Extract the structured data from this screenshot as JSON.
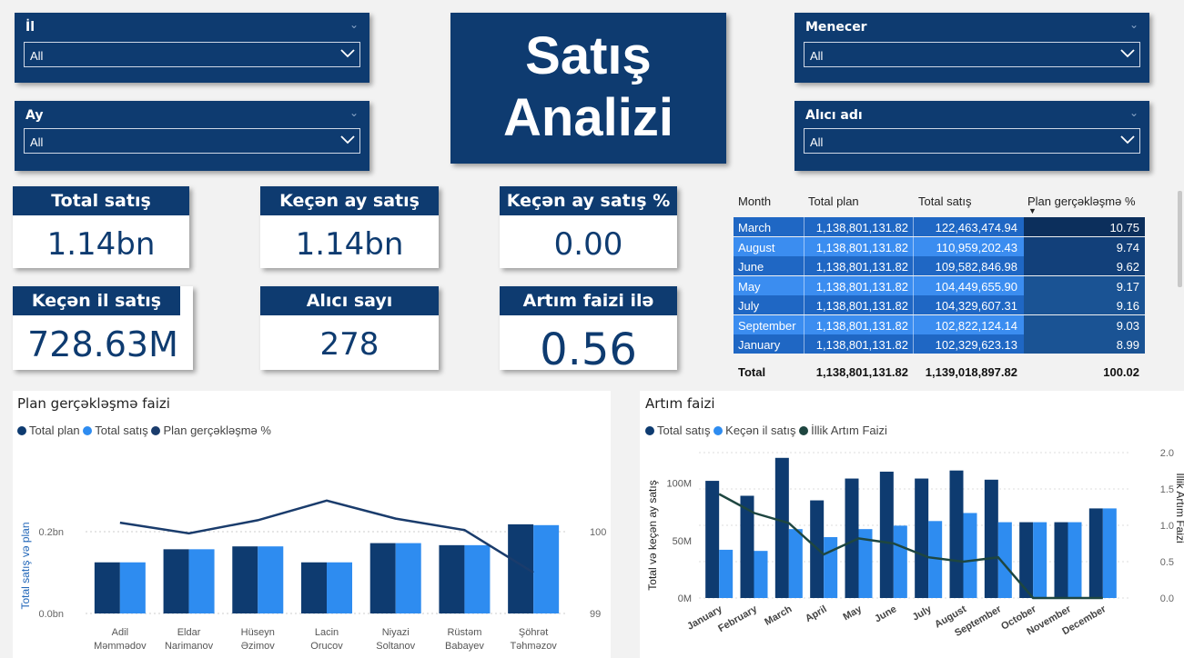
{
  "colors": {
    "navy": "#0e3b70",
    "blue": "#2e8cf0",
    "dark_line": "#1a3c6c",
    "green_line": "#1e4640"
  },
  "slicers": {
    "year": {
      "title": "İl",
      "value": "All"
    },
    "month": {
      "title": "Ay",
      "value": "All"
    },
    "manager": {
      "title": "Menecer",
      "value": "All"
    },
    "buyer": {
      "title": "Alıcı adı",
      "value": "All"
    }
  },
  "title": {
    "line1": "Satış",
    "line2": "Analizi"
  },
  "cards": {
    "total_sales": {
      "label": "Total satış",
      "value": "1.14bn"
    },
    "last_month_sales": {
      "label": "Keçən ay satış",
      "value": "1.14bn"
    },
    "last_month_pct": {
      "label": "Keçən ay satış %",
      "value": "0.00"
    },
    "last_year_sales": {
      "label": "Keçən il satış",
      "value": "728.63M"
    },
    "buyer_count": {
      "label": "Alıcı sayı",
      "value": "278"
    },
    "growth_rate": {
      "label": "Artım faizi ilə görə",
      "value": "0.56"
    }
  },
  "table": {
    "headers": [
      "Month",
      "Total plan",
      "Total satış",
      "Plan gerçəkləşmə %"
    ],
    "rows": [
      [
        "March",
        "1,138,801,131.82",
        "122,463,474.94",
        "10.75"
      ],
      [
        "August",
        "1,138,801,131.82",
        "110,959,202.43",
        "9.74"
      ],
      [
        "June",
        "1,138,801,131.82",
        "109,582,846.98",
        "9.62"
      ],
      [
        "May",
        "1,138,801,131.82",
        "104,449,655.90",
        "9.17"
      ],
      [
        "July",
        "1,138,801,131.82",
        "104,329,607.31",
        "9.16"
      ],
      [
        "September",
        "1,138,801,131.82",
        "102,822,124.14",
        "9.03"
      ],
      [
        "January",
        "1,138,801,131.82",
        "102,329,623.13",
        "8.99"
      ]
    ],
    "total": [
      "Total",
      "1,138,801,131.82",
      "1,139,018,897.82",
      "100.02"
    ]
  },
  "chart_data": [
    {
      "type": "bar",
      "title": "Plan gerçəkləşmə faizi",
      "ylabel": "Total satış və plan",
      "series": [
        {
          "name": "Total plan",
          "values": [
            0.125,
            0.157,
            0.164,
            0.125,
            0.172,
            0.167,
            0.218
          ]
        },
        {
          "name": "Total satış",
          "values": [
            0.125,
            0.157,
            0.164,
            0.125,
            0.172,
            0.167,
            0.216
          ]
        },
        {
          "name": "Plan gerçəkləşmə %",
          "values": [
            100.11,
            99.98,
            100.14,
            100.38,
            100.16,
            100.02,
            99.5
          ]
        }
      ],
      "categories": [
        [
          "Adil",
          "Məmmədov"
        ],
        [
          "Eldar",
          "Narimanov"
        ],
        [
          "Hüseyn",
          "Əzimov"
        ],
        [
          "Lacin",
          "Orucov"
        ],
        [
          "Niyazi",
          "Soltanov"
        ],
        [
          "Rüstəm",
          "Babayev"
        ],
        [
          "Şöhrət",
          "Təhməzov"
        ]
      ],
      "y_ticks": [
        "0.0bn",
        "0.2bn"
      ],
      "y2_ticks": [
        "99",
        "100"
      ],
      "ylim": [
        0,
        0.3
      ],
      "y2lim": [
        99,
        100.5
      ]
    },
    {
      "type": "bar",
      "title": "Artım faizi",
      "ylabel": "Total və keçən ay satış",
      "y2label": "İllik Artım Faizi",
      "categories": [
        "January",
        "February",
        "March",
        "April",
        "May",
        "June",
        "July",
        "August",
        "September",
        "October",
        "November",
        "December"
      ],
      "series": [
        {
          "name": "Total satış",
          "values": [
            102,
            89,
            122,
            85,
            104,
            110,
            104,
            111,
            103,
            66,
            66,
            78
          ]
        },
        {
          "name": "Keçən il satış",
          "values": [
            42,
            41,
            60,
            53,
            60,
            63,
            67,
            74,
            66,
            66,
            66,
            78
          ]
        },
        {
          "name": "İllik Artım Faizi",
          "values": [
            1.43,
            1.17,
            1.03,
            0.6,
            0.82,
            0.75,
            0.56,
            0.5,
            0.56,
            0.0,
            0.0,
            0.0
          ]
        }
      ],
      "y_ticks": [
        "0M",
        "50M",
        "100M"
      ],
      "y2_ticks": [
        "0.0",
        "0.5",
        "1.0",
        "1.5",
        "2.0"
      ],
      "ylim": [
        0,
        125
      ],
      "y2lim": [
        0,
        2.0
      ]
    }
  ]
}
